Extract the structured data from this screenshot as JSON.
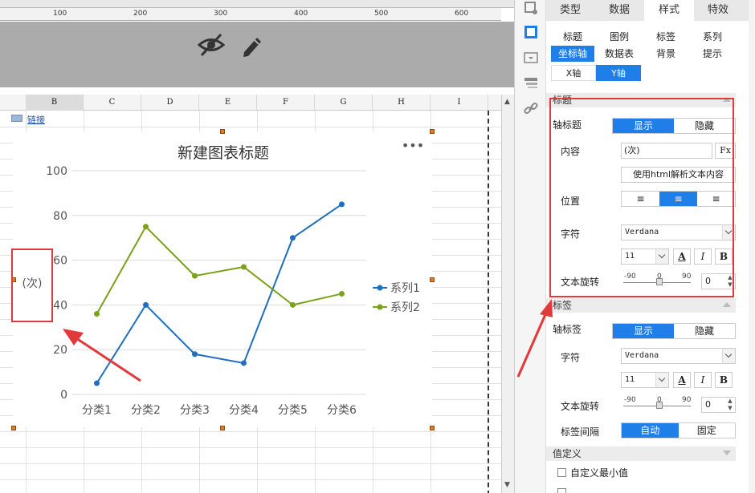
{
  "ruler": {
    "marks": [
      "100",
      "200",
      "300",
      "400",
      "500",
      "600"
    ]
  },
  "sheet": {
    "columns": [
      "B",
      "C",
      "D",
      "E",
      "F",
      "G",
      "H",
      "I"
    ],
    "link_text": "链接"
  },
  "chart": {
    "more_icon": "more-dots-icon",
    "axis_title": "(次)"
  },
  "chart_data": {
    "type": "line",
    "title": "新建图表标题",
    "categories": [
      "分类1",
      "分类2",
      "分类3",
      "分类4",
      "分类5",
      "分类6"
    ],
    "ylim": [
      0,
      100
    ],
    "yticks": [
      "0",
      "20",
      "40",
      "60",
      "80",
      "100"
    ],
    "ylabel": "(次)",
    "legend_position": "right",
    "grid": true,
    "series": [
      {
        "name": "系列1",
        "color": "#1f6fc0",
        "values": [
          5,
          40,
          18,
          14,
          70,
          85
        ]
      },
      {
        "name": "系列2",
        "color": "#7aa21a",
        "values": [
          36,
          75,
          53,
          57,
          40,
          45
        ]
      }
    ]
  },
  "panel": {
    "main_tabs": [
      "类型",
      "数据",
      "样式",
      "特效"
    ],
    "sub_tabs_row1": [
      "标题",
      "图例",
      "标签",
      "系列"
    ],
    "sub_tabs_row2": [
      "坐标轴",
      "数据表",
      "背景",
      "提示"
    ],
    "axis_buttons": [
      "X轴",
      "Y轴"
    ],
    "title_section": {
      "header": "标题",
      "axis_title_label": "轴标题",
      "show": "显示",
      "hide": "隐藏",
      "content_label": "内容",
      "content_value": "(次)",
      "formula_btn": "Fx",
      "html_parse_btn": "使用html解析文本内容",
      "position_label": "位置",
      "font_label": "字符",
      "font_value": "Verdana",
      "size_value": "11",
      "bold": "B",
      "italic": "I",
      "rotate_label": "文本旋转",
      "rotate_min": "-90",
      "rotate_mid": "0",
      "rotate_max": "90",
      "rotate_value": "0"
    },
    "label_section": {
      "header": "标签",
      "axis_label_label": "轴标签",
      "show": "显示",
      "hide": "隐藏",
      "font_label": "字符",
      "font_value": "Verdana",
      "size_value": "11",
      "bold": "B",
      "italic": "I",
      "rotate_label": "文本旋转",
      "rotate_min": "-90",
      "rotate_mid": "0",
      "rotate_max": "90",
      "rotate_value": "0",
      "interval_label": "标签间隔",
      "auto": "自动",
      "fixed": "固定"
    },
    "value_section": {
      "header": "值定义",
      "custom_min": "自定义最小值"
    }
  }
}
